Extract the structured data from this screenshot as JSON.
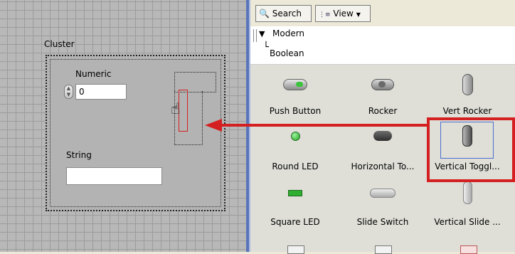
{
  "front_panel": {
    "cluster_label": "Cluster",
    "numeric_label": "Numeric",
    "numeric_value": "0",
    "string_label": "String",
    "string_value": ""
  },
  "palette": {
    "toolbar": {
      "search_label": "Search",
      "view_label": "View"
    },
    "tree": {
      "parent": "Modern",
      "child": "Boolean"
    },
    "controls": [
      {
        "label": "Push Button",
        "icon": "push-button-icon"
      },
      {
        "label": "Rocker",
        "icon": "rocker-icon"
      },
      {
        "label": "Vert Rocker",
        "icon": "vert-rocker-icon"
      },
      {
        "label": "Round LED",
        "icon": "round-led-icon"
      },
      {
        "label": "Horizontal To...",
        "icon": "horizontal-toggle-icon"
      },
      {
        "label": "Vertical Toggl...",
        "icon": "vertical-toggle-icon"
      },
      {
        "label": "Square LED",
        "icon": "square-led-icon"
      },
      {
        "label": "Slide Switch",
        "icon": "slide-switch-icon"
      },
      {
        "label": "Vertical Slide ...",
        "icon": "vertical-slide-icon"
      }
    ]
  },
  "colors": {
    "highlight_red": "#d42020",
    "selection_blue": "#4a6fd0",
    "led_green": "#2fae2f"
  }
}
